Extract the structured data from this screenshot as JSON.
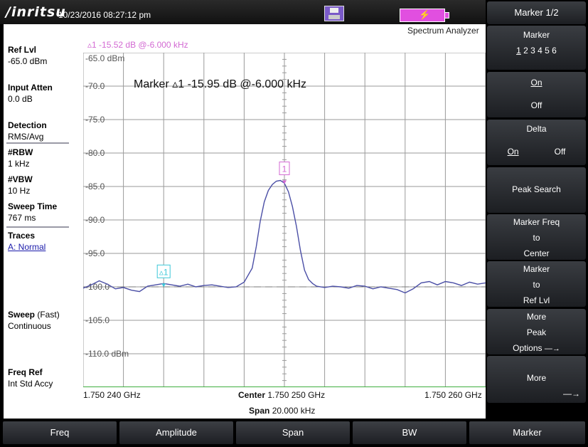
{
  "header": {
    "logo": "/inritsu",
    "datetime": "10/23/2016 08:27:12 pm",
    "mode": "Spectrum Analyzer"
  },
  "side": {
    "ref_lvl_label": "Ref Lvl",
    "ref_lvl_value": "-65.0 dBm",
    "input_atten_label": "Input Atten",
    "input_atten_value": "0.0 dB",
    "detection_label": "Detection",
    "detection_value": "RMS/Avg",
    "rbw_label": "#RBW",
    "rbw_value": "1 kHz",
    "vbw_label": "#VBW",
    "vbw_value": "10 Hz",
    "sweep_time_label": "Sweep Time",
    "sweep_time_value": "767 ms",
    "traces_label": "Traces",
    "traces_value": "A: Normal",
    "sweep_label": "Sweep",
    "sweep_mode": "(Fast)",
    "sweep_value": "Continuous",
    "freq_ref_label": "Freq Ref",
    "freq_ref_value": "Int Std Accy"
  },
  "plot": {
    "delta_readout": "▵1 -15.52 dB @-6.000 kHz",
    "marker_readout": "Marker ▵1 -15.95 dB @-6.000 kHz",
    "x_left": "1.750 240 GHz",
    "x_right": "1.750 260 GHz",
    "x_center_label": "Center",
    "x_center_value": "1.750 250 GHz",
    "x_span_label": "Span",
    "x_span_value": "20.000 kHz",
    "marker1_label": "1",
    "delta_marker_label": "▵1"
  },
  "chart_data": {
    "type": "line",
    "xlabel": "",
    "ylabel": "",
    "x_unit": "kHz offset",
    "xlim": [
      -10,
      10
    ],
    "ylim": [
      -115,
      -65
    ],
    "y_tick_labels": [
      "-65.0 dBm",
      "-70.0",
      "-75.0",
      "-80.0",
      "-85.0",
      "-90.0",
      "-95.0",
      "-100.0",
      "-105.0",
      "-110.0 dBm"
    ],
    "grid": true,
    "trace_color": "#4b4fa6",
    "series": [
      {
        "x": [
          -10,
          -9.6,
          -9.2,
          -8.8,
          -8.4,
          -8,
          -7.6,
          -7.2,
          -6.8,
          -6.4,
          -6,
          -5.6,
          -5.2,
          -4.8,
          -4.4,
          -4,
          -3.6,
          -3.2,
          -2.8,
          -2.4,
          -2,
          -1.6,
          -1.4,
          -1.2,
          -1,
          -0.8,
          -0.6,
          -0.4,
          -0.2,
          0,
          0.2,
          0.4,
          0.6,
          0.8,
          1,
          1.2,
          1.4,
          1.6,
          2,
          2.4,
          2.8,
          3.2,
          3.6,
          4,
          4.4,
          4.8,
          5.2,
          5.6,
          6,
          6.4,
          6.8,
          7.2,
          7.6,
          8,
          8.4,
          8.8,
          9.2,
          9.6,
          10
        ],
        "y": [
          -100.2,
          -99.7,
          -99.1,
          -99.6,
          -100.3,
          -100.1,
          -100.5,
          -100.7,
          -99.9,
          -99.7,
          -99.5,
          -99.7,
          -99.9,
          -99.6,
          -100.0,
          -99.8,
          -99.7,
          -99.9,
          -100.1,
          -100.0,
          -99.3,
          -97.2,
          -94.0,
          -90.2,
          -87.3,
          -85.6,
          -84.7,
          -84.2,
          -84.1,
          -84.5,
          -85.8,
          -88.0,
          -91.0,
          -94.6,
          -97.5,
          -98.9,
          -99.5,
          -99.9,
          -100.1,
          -99.9,
          -100.0,
          -100.2,
          -99.8,
          -99.9,
          -100.3,
          -100.0,
          -100.2,
          -100.4,
          -100.9,
          -100.3,
          -99.4,
          -99.2,
          -99.7,
          -99.2,
          -99.4,
          -99.8,
          -99.3,
          -99.6,
          -99.4
        ]
      }
    ],
    "markers": [
      {
        "label": "1",
        "x": 0,
        "y": -84.1
      },
      {
        "label": "▵1",
        "x": -6,
        "y": -99.5
      }
    ],
    "reference_line_y": -100.0
  },
  "softkeys": {
    "header": "Marker 1/2",
    "marker_title": "Marker",
    "marker_selected": "1",
    "marker_others": " 2 3 4 5 6",
    "on": "On",
    "off": "Off",
    "delta_title": "Delta",
    "delta_on": "On",
    "delta_off": "Off",
    "peak_search": "Peak Search",
    "marker_freq_1": "Marker Freq",
    "marker_freq_2": "to",
    "marker_freq_3": "Center",
    "marker_ref_1": "Marker",
    "marker_ref_2": "to",
    "marker_ref_3": "Ref Lvl",
    "more_peak_1": "More",
    "more_peak_2": "Peak",
    "more_peak_3": "Options",
    "more": "More",
    "arrow": "—→"
  },
  "bottom": {
    "freq": "Freq",
    "amplitude": "Amplitude",
    "span": "Span",
    "bw": "BW",
    "marker": "Marker"
  },
  "colors": {
    "marker_magenta": "#d36ad3",
    "delta_cyan": "#3cc8d8",
    "battery": "#e14fe0"
  }
}
